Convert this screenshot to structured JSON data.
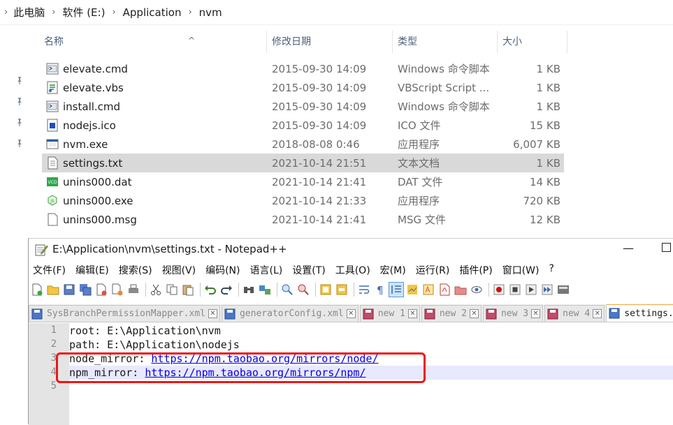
{
  "explorer": {
    "breadcrumbs": [
      "此电脑",
      "软件 (E:)",
      "Application",
      "nvm"
    ],
    "columns": {
      "name": "名称",
      "date": "修改日期",
      "type": "类型",
      "size": "大小"
    },
    "files": [
      {
        "name": "elevate.cmd",
        "date": "2015-09-30 14:09",
        "type": "Windows 命令脚本",
        "size": "1 KB",
        "icon": "cmd-file-icon"
      },
      {
        "name": "elevate.vbs",
        "date": "2015-09-30 14:09",
        "type": "VBScript Script ...",
        "size": "1 KB",
        "icon": "vbs-file-icon"
      },
      {
        "name": "install.cmd",
        "date": "2015-09-30 14:09",
        "type": "Windows 命令脚本",
        "size": "1 KB",
        "icon": "cmd-file-icon"
      },
      {
        "name": "nodejs.ico",
        "date": "2015-09-30 14:09",
        "type": "ICO 文件",
        "size": "15 KB",
        "icon": "ico-file-icon"
      },
      {
        "name": "nvm.exe",
        "date": "2018-08-08 0:46",
        "type": "应用程序",
        "size": "6,007 KB",
        "icon": "exe-file-icon"
      },
      {
        "name": "settings.txt",
        "date": "2021-10-14 21:51",
        "type": "文本文档",
        "size": "1 KB",
        "icon": "txt-file-icon",
        "selected": true
      },
      {
        "name": "unins000.dat",
        "date": "2021-10-14 21:41",
        "type": "DAT 文件",
        "size": "14 KB",
        "icon": "vcd-file-icon"
      },
      {
        "name": "unins000.exe",
        "date": "2021-10-14 21:33",
        "type": "应用程序",
        "size": "720 KB",
        "icon": "setup-exe-icon"
      },
      {
        "name": "unins000.msg",
        "date": "2021-10-14 21:41",
        "type": "MSG 文件",
        "size": "12 KB",
        "icon": "blank-file-icon"
      }
    ]
  },
  "notepad": {
    "title": "E:\\Application\\nvm\\settings.txt - Notepad++",
    "menu": [
      "文件(F)",
      "编辑(E)",
      "搜索(S)",
      "视图(V)",
      "编码(N)",
      "语言(L)",
      "设置(T)",
      "工具(O)",
      "宏(M)",
      "运行(R)",
      "插件(P)",
      "窗口(W)",
      "?"
    ],
    "tabs": [
      {
        "label": "SysBranchPermissionMapper.xml",
        "active": false
      },
      {
        "label": "generatorConfig.xml",
        "active": false
      },
      {
        "label": "new 1",
        "active": false
      },
      {
        "label": "new 2",
        "active": false
      },
      {
        "label": "new 3",
        "active": false
      },
      {
        "label": "new 4",
        "active": false
      },
      {
        "label": "settings.txt",
        "active": true
      }
    ],
    "line_numbers": [
      "1",
      "2",
      "3",
      "4",
      "5"
    ],
    "lines": [
      {
        "text": "root: E:\\Application\\nvm"
      },
      {
        "text": "path: E:\\Application\\nodejs"
      },
      {
        "prefix": "node_mirror: ",
        "link": "https://npm.taobao.org/mirrors/node/"
      },
      {
        "prefix": "npm_mirror: ",
        "link": "https://npm.taobao.org/mirrors/npm/"
      },
      {
        "text": ""
      }
    ],
    "current_line": 4,
    "colors": {
      "highlight_box": "#f01414",
      "current_line_bg": "#e8e8ff",
      "link": "#0000e0"
    }
  }
}
